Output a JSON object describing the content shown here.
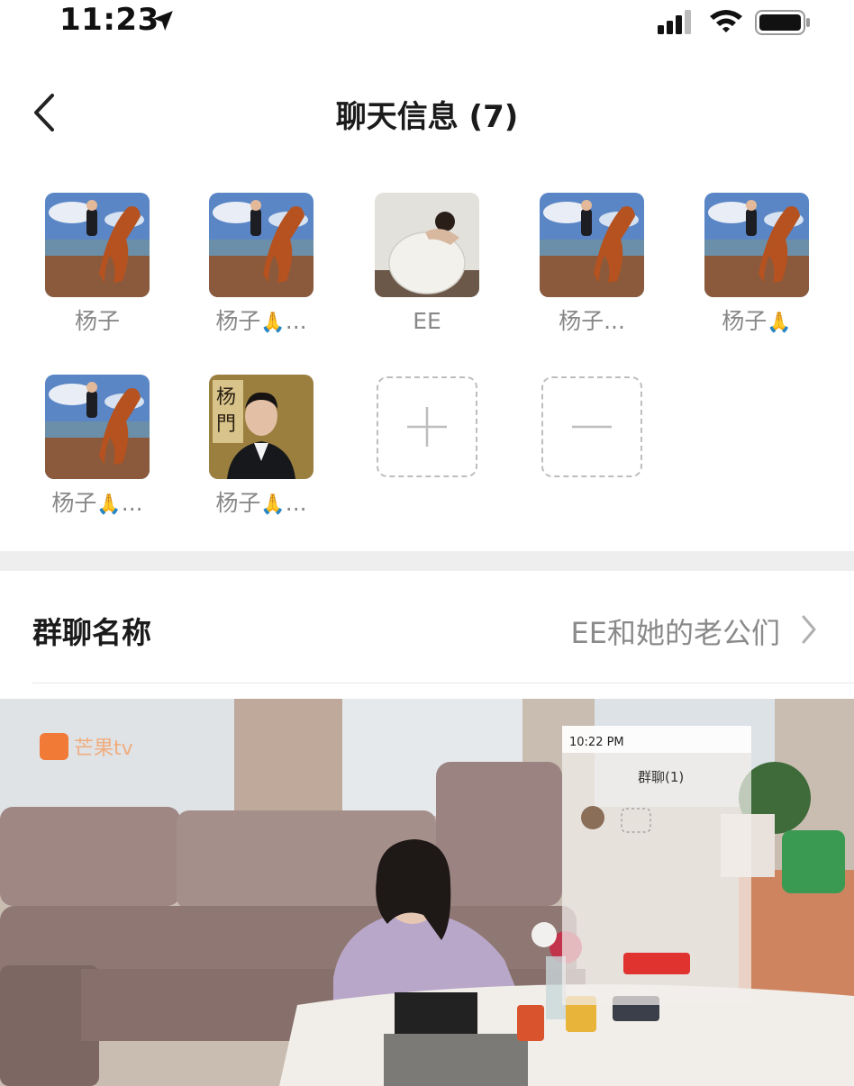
{
  "status_bar": {
    "time": "11:23"
  },
  "header": {
    "title": "聊天信息 (7)"
  },
  "members": [
    {
      "name": "杨子",
      "avatar": "horse-rider-avatar"
    },
    {
      "name": "杨子",
      "emoji": "🙏",
      "suffix": "...",
      "avatar": "horse-rider-avatar"
    },
    {
      "name": "EE",
      "avatar": "woman-in-egg-avatar"
    },
    {
      "name": "杨子",
      "suffix": "...",
      "avatar": "horse-rider-avatar"
    },
    {
      "name": "杨子",
      "emoji": "🙏",
      "avatar": "horse-rider-avatar"
    },
    {
      "name": "杨子",
      "emoji": "🙏",
      "suffix": "...",
      "avatar": "horse-rider-avatar"
    },
    {
      "name": "杨子",
      "emoji": "🙏",
      "suffix": "...",
      "avatar": "man-in-suit-avatar"
    }
  ],
  "controls": {
    "add": "add-member-icon",
    "remove": "remove-member-icon"
  },
  "group_name": {
    "label": "群聊名称",
    "value": "EE和她的老公们"
  },
  "video": {
    "logo_text": "芒果tv",
    "overlay_time": "10:22 PM",
    "overlay_title": "群聊(1)"
  },
  "colors": {
    "title": "#1b1b1b",
    "muted": "#8a8a8a",
    "divider": "#eeeeee",
    "dashed": "#bdbdbd"
  }
}
